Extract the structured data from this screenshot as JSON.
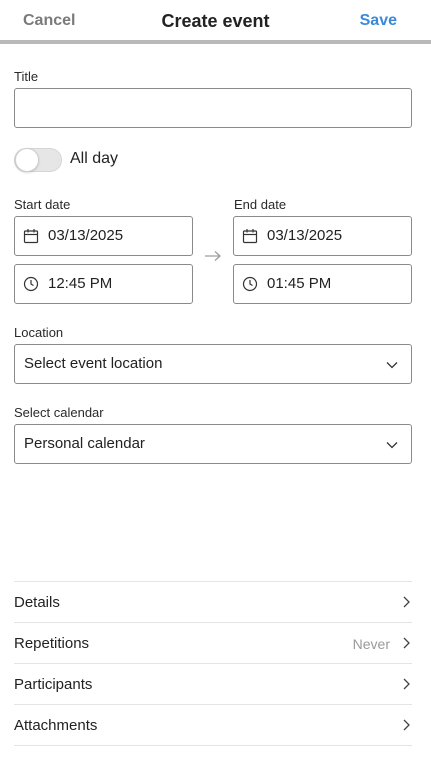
{
  "header": {
    "cancel_label": "Cancel",
    "title": "Create event",
    "save_label": "Save"
  },
  "form": {
    "title_label": "Title",
    "title_value": "",
    "all_day": {
      "label": "All day",
      "enabled": false
    },
    "start": {
      "label": "Start date",
      "date": "03/13/2025",
      "time": "12:45 PM"
    },
    "end": {
      "label": "End date",
      "date": "03/13/2025",
      "time": "01:45 PM"
    },
    "location": {
      "label": "Location",
      "placeholder": "Select event location"
    },
    "calendar": {
      "label": "Select calendar",
      "value": "Personal calendar"
    }
  },
  "sections": [
    {
      "label": "Details",
      "value": ""
    },
    {
      "label": "Repetitions",
      "value": "Never"
    },
    {
      "label": "Participants",
      "value": ""
    },
    {
      "label": "Attachments",
      "value": ""
    }
  ],
  "colors": {
    "accent": "#3b8ad8",
    "muted_text": "#7a7a7a",
    "border": "#8a8a8a"
  },
  "icons": {
    "date": "calendar-icon",
    "time": "clock-icon",
    "range": "arrow-right-icon",
    "dropdown": "chevron-down-icon",
    "row": "chevron-right-icon"
  }
}
